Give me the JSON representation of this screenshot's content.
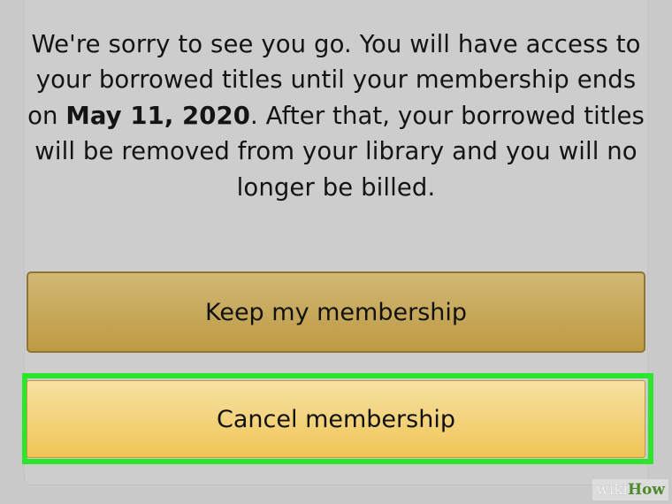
{
  "message": {
    "part1": "We're sorry to see you go. You will have access to your borrowed titles until your membership ends on ",
    "date": "May 11, 2020",
    "part2": ". After that, your borrowed titles will be removed from your library and you will no longer be billed."
  },
  "buttons": {
    "keep_label": "Keep my membership",
    "cancel_label": "Cancel membership"
  },
  "watermark": {
    "part1": "wiki",
    "part2": "How"
  },
  "colors": {
    "keep_button": "#c5a75a",
    "cancel_button": "#f3d27a",
    "highlight": "#2ce62c",
    "background": "#c9c9c9"
  }
}
